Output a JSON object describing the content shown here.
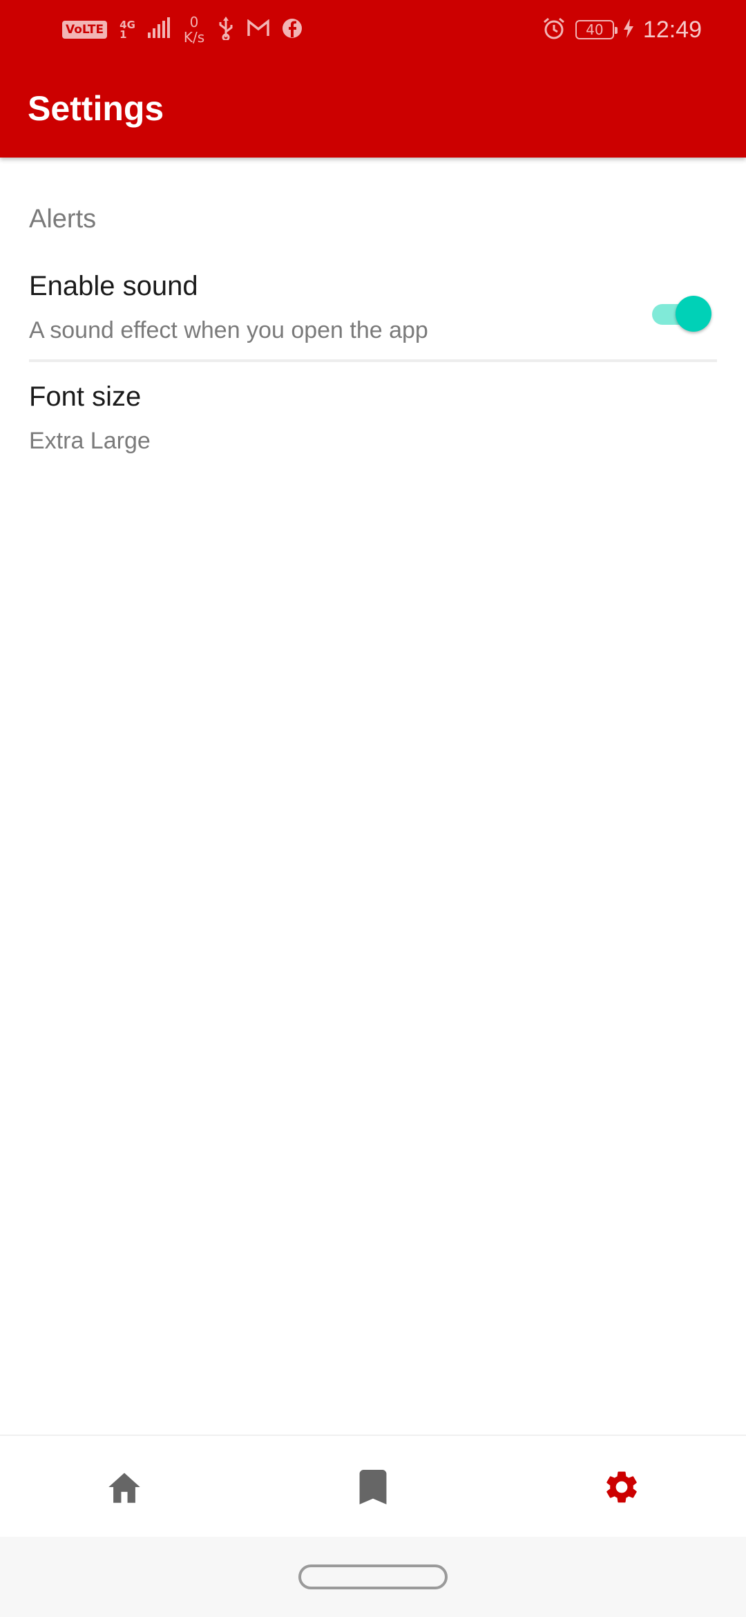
{
  "status_bar": {
    "volte": "VoLTE",
    "network_type": "4G",
    "network_sub": "1",
    "speed_value": "0",
    "speed_unit": "K/s",
    "battery_level": "40",
    "time": "12:49",
    "icons": [
      "volte-icon",
      "signal-icon",
      "usb-icon",
      "gmail-icon",
      "facebook-icon",
      "alarm-icon",
      "battery-icon",
      "charging-icon"
    ]
  },
  "app_bar": {
    "title": "Settings",
    "color": "#cc0000"
  },
  "alerts_section": {
    "header": "Alerts",
    "enable_sound": {
      "title": "Enable sound",
      "summary": "A sound effect when you open the app",
      "enabled": true,
      "accent_color": "#00d1b7"
    },
    "font_size": {
      "title": "Font size",
      "summary": "Extra Large"
    }
  },
  "bottom_nav": {
    "items": [
      {
        "icon": "home-icon",
        "active": false
      },
      {
        "icon": "bookmark-icon",
        "active": false
      },
      {
        "icon": "gear-icon",
        "active": true
      }
    ],
    "active_color": "#cc0000",
    "inactive_color": "#666666"
  }
}
